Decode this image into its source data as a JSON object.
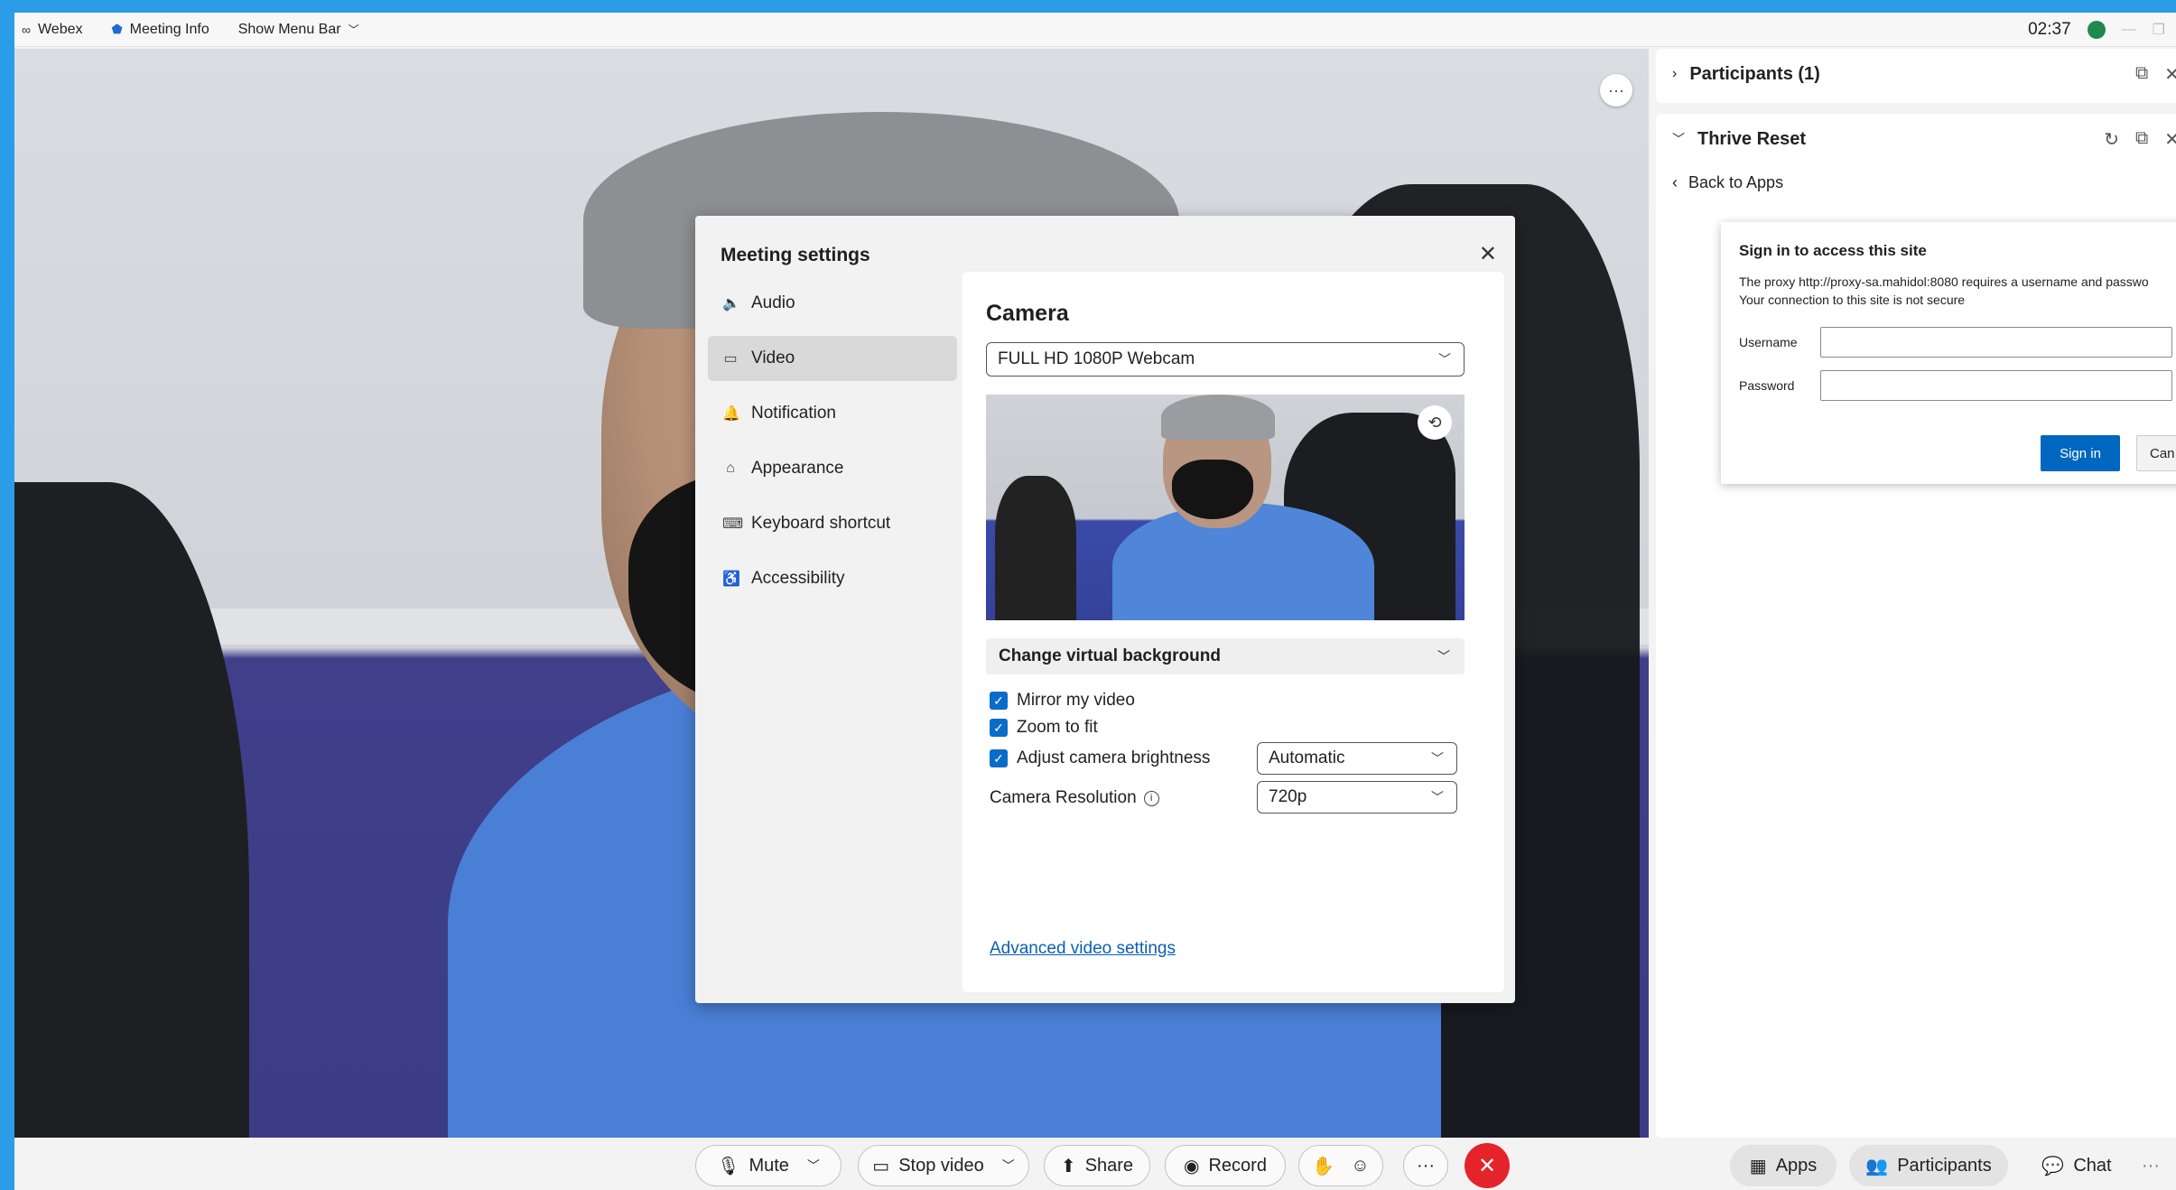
{
  "titlebar": {
    "app_name": "Webex",
    "meeting_info": "Meeting Info",
    "show_menu_bar": "Show Menu Bar",
    "clock": "02:37"
  },
  "stage": {
    "more_label": "···"
  },
  "right_panel": {
    "participants_title": "Participants (1)",
    "app_title": "Thrive Reset",
    "back_to_apps": "Back to Apps",
    "sign_in": {
      "title": "Sign in to access this site",
      "message_line1": "The proxy http://proxy-sa.mahidol:8080 requires a username and passwo",
      "message_line2": "Your connection to this site is not secure",
      "username_label": "Username",
      "password_label": "Password",
      "username_value": "",
      "password_value": "",
      "sign_in_button": "Sign in",
      "cancel_button": "Can"
    }
  },
  "settings": {
    "title": "Meeting settings",
    "close": "✕",
    "nav": [
      {
        "label": "Audio",
        "icon": "speaker-icon",
        "glyph": "🔈"
      },
      {
        "label": "Video",
        "icon": "camera-icon",
        "glyph": "▭"
      },
      {
        "label": "Notification",
        "icon": "bell-icon",
        "glyph": "🔔"
      },
      {
        "label": "Appearance",
        "icon": "paint-icon",
        "glyph": "⌂"
      },
      {
        "label": "Keyboard shortcut",
        "icon": "keyboard-icon",
        "glyph": "⌨"
      },
      {
        "label": "Accessibility",
        "icon": "accessibility-icon",
        "glyph": "♿"
      }
    ],
    "active_nav": "Video",
    "camera_heading": "Camera",
    "camera_device": "FULL HD 1080P Webcam",
    "virtual_background": "Change virtual background",
    "mirror_video": "Mirror my video",
    "mirror_checked": true,
    "zoom_to_fit": "Zoom to fit",
    "zoom_checked": true,
    "adjust_brightness": "Adjust camera brightness",
    "brightness_checked": true,
    "brightness_value": "Automatic",
    "resolution_label": "Camera Resolution",
    "resolution_value": "720p",
    "advanced_link": "Advanced video settings"
  },
  "toolbar": {
    "mute": "Mute",
    "stop_video": "Stop video",
    "share": "Share",
    "record": "Record",
    "more": "···",
    "apps": "Apps",
    "participants": "Participants",
    "chat": "Chat",
    "end": "✕"
  },
  "colors": {
    "accent": "#0a6cc9",
    "end_call": "#e5232b",
    "frame": "#2b9de8"
  }
}
